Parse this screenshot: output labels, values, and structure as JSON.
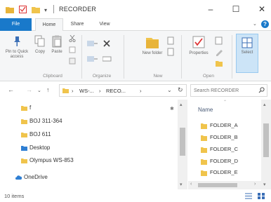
{
  "window": {
    "title": "RECORDER",
    "controls": {
      "minimize": "–",
      "maximize": "☐",
      "close": "✕"
    }
  },
  "ribbon_tabs": {
    "file": "File",
    "home": "Home",
    "share": "Share",
    "view": "View",
    "help": "?"
  },
  "ribbon": {
    "clipboard": {
      "pin_to_quick_access": "Pin to Quick access",
      "copy": "Copy",
      "paste": "Paste",
      "group_label": "Clipboard"
    },
    "organize": {
      "group_label": "Organize"
    },
    "new": {
      "new_folder": "New folder",
      "group_label": "New"
    },
    "open": {
      "properties": "Properties",
      "group_label": "Open"
    },
    "select": {
      "select": "Select"
    }
  },
  "address_bar": {
    "crumbs": [
      "WS-...",
      "RECO..."
    ],
    "search_placeholder": "Search RECORDER"
  },
  "navigation_pane": {
    "items": [
      {
        "label": "f",
        "icon": "folder-icon"
      },
      {
        "label": "BOJ 311-364",
        "icon": "folder-icon"
      },
      {
        "label": "BOJ 611",
        "icon": "folder-icon"
      },
      {
        "label": "Desktop",
        "icon": "desktop-folder-icon"
      },
      {
        "label": "Olympus WS-853",
        "icon": "folder-icon"
      },
      {
        "label": "OneDrive",
        "icon": "cloud-icon"
      }
    ]
  },
  "file_list": {
    "column_name": "Name",
    "files": [
      "FOLDER_A",
      "FOLDER_B",
      "FOLDER_C",
      "FOLDER_D",
      "FOLDER_E"
    ]
  },
  "status_bar": {
    "item_count": "10 items"
  },
  "colors": {
    "accent": "#1979ca",
    "folder": "#f0c44c",
    "ribbon_bg": "#f5f6f7"
  }
}
